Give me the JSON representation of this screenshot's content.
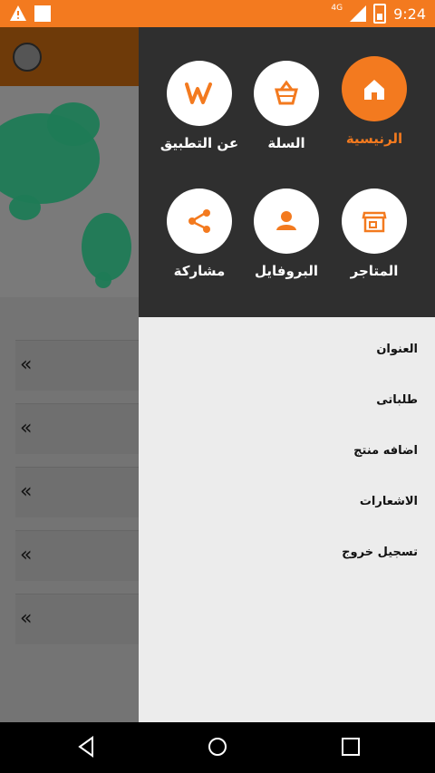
{
  "status_bar": {
    "time": "9:24",
    "network": "4G"
  },
  "drawer": {
    "tiles": [
      {
        "label": "الرنيسية",
        "icon": "home-icon"
      },
      {
        "label": "السلة",
        "icon": "basket-icon"
      },
      {
        "label": "عن التطبيق",
        "icon": "app-logo-icon"
      },
      {
        "label": "المتاجر",
        "icon": "store-icon"
      },
      {
        "label": "البروفايل",
        "icon": "profile-icon"
      },
      {
        "label": "مشاركة",
        "icon": "share-icon"
      }
    ],
    "menu_items": [
      "العنوان",
      "طلباتى",
      "اضافه منتج",
      "الاشعارات",
      "تسجيل خروج"
    ]
  },
  "colors": {
    "accent": "#f37a1f",
    "drawer_header": "#2f2f2f",
    "menu_bg": "#ececec"
  }
}
